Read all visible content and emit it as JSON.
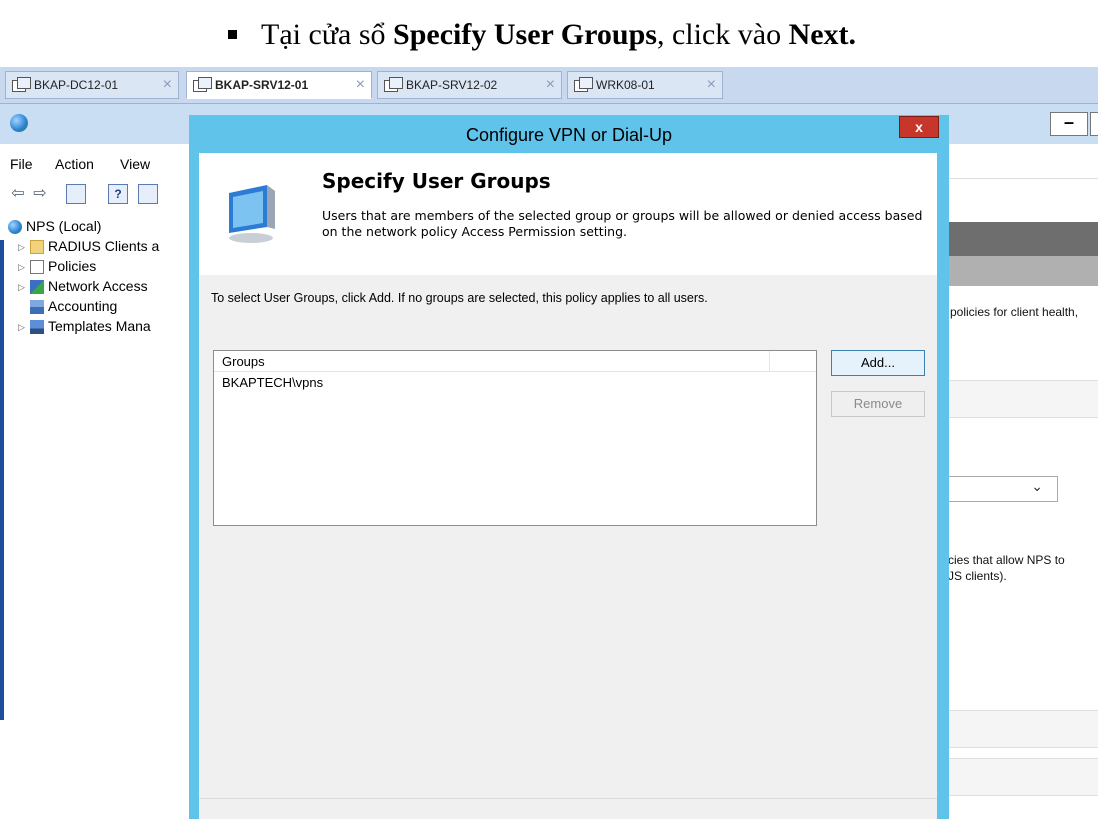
{
  "doc": {
    "heading_prefix": "Tại cửa sổ ",
    "heading_bold1": "Specify User Groups",
    "heading_mid": ", click vào ",
    "heading_bold2": "Next."
  },
  "tabs": [
    {
      "label": "BKAP-DC12-01",
      "active": false
    },
    {
      "label": "BKAP-SRV12-01",
      "active": true
    },
    {
      "label": "BKAP-SRV12-02",
      "active": false
    },
    {
      "label": "WRK08-01",
      "active": false
    }
  ],
  "tab_close_glyph": "×",
  "mmc": {
    "menu": [
      "File",
      "Action",
      "View"
    ],
    "minimize_glyph": "–",
    "tree": [
      {
        "label": "NPS (Local)",
        "icon": "nps-icon"
      },
      {
        "label": "RADIUS Clients a",
        "icon": "folder-icon"
      },
      {
        "label": "Policies",
        "icon": "policies-icon"
      },
      {
        "label": "Network Access",
        "icon": "network-access-icon"
      },
      {
        "label": "Accounting",
        "icon": "accounting-icon"
      },
      {
        "label": "Templates Mana",
        "icon": "templates-icon"
      }
    ],
    "right_text_1": "policies for client health,",
    "right_text_2a": "cies that allow NPS to",
    "right_text_2b": "JS clients)."
  },
  "dialog": {
    "title": "Configure VPN or Dial-Up",
    "close_glyph": "x",
    "header_title": "Specify User Groups",
    "header_desc": "Users that are members of the selected group or groups will be allowed or denied access based on the network policy Access Permission setting.",
    "instruction": "To select User Groups, click Add. If no groups are selected, this policy applies to all users.",
    "list_header": "Groups",
    "groups": [
      "BKAPTECH\\vpns"
    ],
    "add_label": "Add...",
    "remove_label": "Remove"
  },
  "colors": {
    "dialog_frame": "#5fc3ea",
    "close_button": "#c6362b",
    "tabbar": "#c8d8ee"
  }
}
